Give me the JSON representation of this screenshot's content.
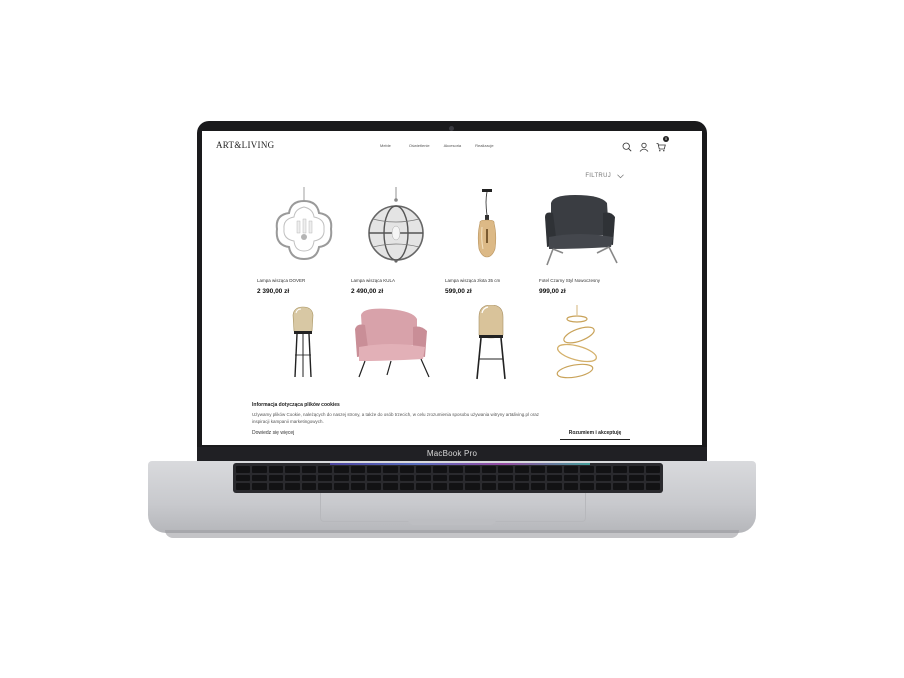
{
  "device": {
    "label": "MacBook Pro"
  },
  "header": {
    "logo": "ART&LIVING",
    "nav": [
      "Meble",
      "Oświetlenie",
      "Akcesoria",
      "Realizacje"
    ],
    "cart_count": "0"
  },
  "filter": {
    "label": "FILTRUJ"
  },
  "products": [
    {
      "name": "Lampa wisząca DOVER",
      "price": "2 390,00 zł"
    },
    {
      "name": "Lampa wisząca KULA",
      "price": "2 490,00 zł"
    },
    {
      "name": "Lampa wisząca złota 35 cm",
      "price": "599,00 zł"
    },
    {
      "name": "Fotel Czarny Styl Nowoczesny",
      "price": "999,00 zł"
    },
    {
      "name": "",
      "price": ""
    },
    {
      "name": "",
      "price": ""
    },
    {
      "name": "",
      "price": ""
    },
    {
      "name": "",
      "price": ""
    }
  ],
  "cookie": {
    "title": "Informacja dotycząca plików cookies",
    "text": "Używamy plików Cookie, należących do naszej strony, a także do osób trzecich, w celu zrozumienia sposobu używania witryny art&living.pl oraz inspiracji kampanii marketingowych.",
    "link": "Dowiedz się więcej",
    "accept": "Rozumiem i akceptuję"
  },
  "colors": {
    "accent": "#222222",
    "lid": "#1a1a1c",
    "base": "#c8c9cd"
  },
  "icons": [
    "search-icon",
    "user-icon",
    "cart-icon",
    "chevron-down-icon"
  ]
}
